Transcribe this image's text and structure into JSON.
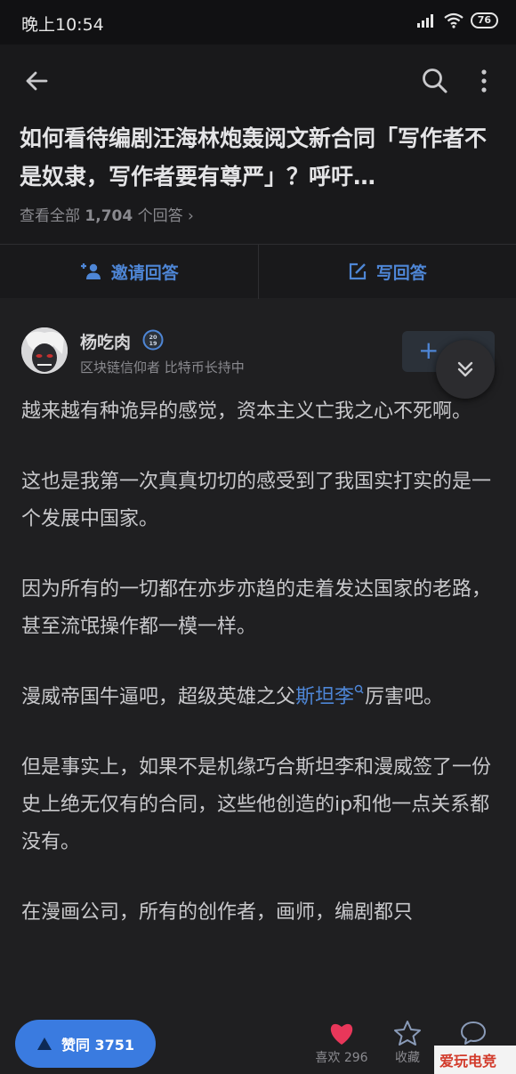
{
  "status_bar": {
    "time": "晚上10:54",
    "battery": "76"
  },
  "question": {
    "title": "如何看待编剧汪海林炮轰阅文新合同「写作者不是奴隶，写作者要有尊严」？呼吁…",
    "count_prefix": "查看全部 ",
    "count_number": "1,704",
    "count_suffix": " 个回答 ›"
  },
  "actions": {
    "invite_label": "邀请回答",
    "write_label": "写回答"
  },
  "author": {
    "name": "杨吃肉",
    "bio": "区块链信仰者 比特币长持中",
    "badge": "2019"
  },
  "follow": {
    "label": "+"
  },
  "content": {
    "p1": "越来越有种诡异的感觉，资本主义亡我之心不死啊。",
    "p2": "这也是我第一次真真切切的感受到了我国实打实的是一个发展中国家。",
    "p3": "因为所有的一切都在亦步亦趋的走着发达国家的老路，甚至流氓操作都一模一样。",
    "p4_before": "漫威帝国牛逼吧，超级英雄之父",
    "p4_link": "斯坦李",
    "p4_after": "厉害吧。",
    "p5": "但是事实上，如果不是机缘巧合斯坦李和漫威签了一份史上绝无仅有的合同，这些他创造的ip和他一点关系都没有。",
    "p6": "在漫画公司，所有的创作者，画师，编剧都只"
  },
  "bottom_bar": {
    "vote_label": "赞同 3751",
    "like_label": "喜欢 296",
    "collect_label": "收藏",
    "watermark": "爱玩电竞"
  },
  "colors": {
    "accent": "#4e86d6",
    "vote_button": "#3a7be0",
    "heart": "#e8375a"
  }
}
